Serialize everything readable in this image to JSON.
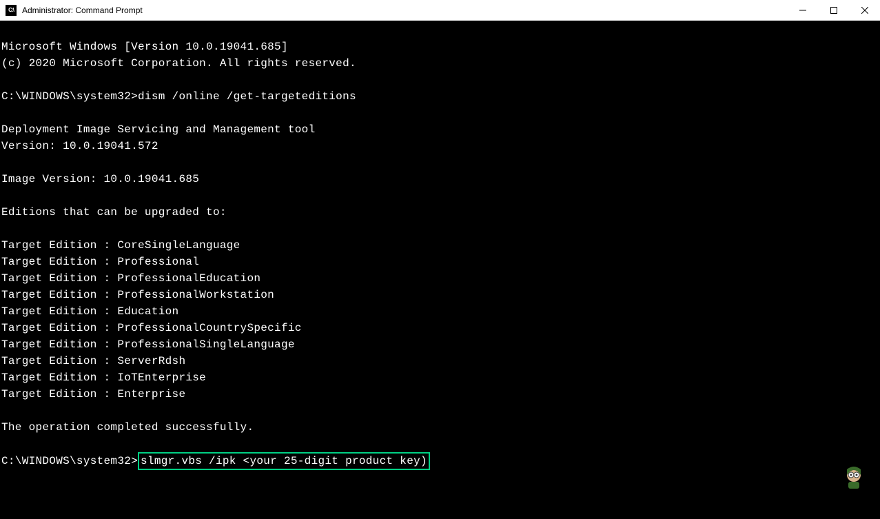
{
  "window": {
    "title": "Administrator: Command Prompt"
  },
  "terminal": {
    "line1": "Microsoft Windows [Version 10.0.19041.685]",
    "line2": "(c) 2020 Microsoft Corporation. All rights reserved.",
    "blank1": "",
    "prompt1_path": "C:\\WINDOWS\\system32>",
    "prompt1_cmd": "dism /online /get-targeteditions",
    "blank2": "",
    "tool_name": "Deployment Image Servicing and Management tool",
    "tool_version": "Version: 10.0.19041.572",
    "blank3": "",
    "image_version": "Image Version: 10.0.19041.685",
    "blank4": "",
    "editions_header": "Editions that can be upgraded to:",
    "blank5": "",
    "ed1": "Target Edition : CoreSingleLanguage",
    "ed2": "Target Edition : Professional",
    "ed3": "Target Edition : ProfessionalEducation",
    "ed4": "Target Edition : ProfessionalWorkstation",
    "ed5": "Target Edition : Education",
    "ed6": "Target Edition : ProfessionalCountrySpecific",
    "ed7": "Target Edition : ProfessionalSingleLanguage",
    "ed8": "Target Edition : ServerRdsh",
    "ed9": "Target Edition : IoTEnterprise",
    "ed10": "Target Edition : Enterprise",
    "blank6": "",
    "success": "The operation completed successfully.",
    "blank7": "",
    "prompt2_path": "C:\\WINDOWS\\system32>",
    "prompt2_cmd": "slmgr.vbs /ipk <your 25-digit product key)"
  }
}
